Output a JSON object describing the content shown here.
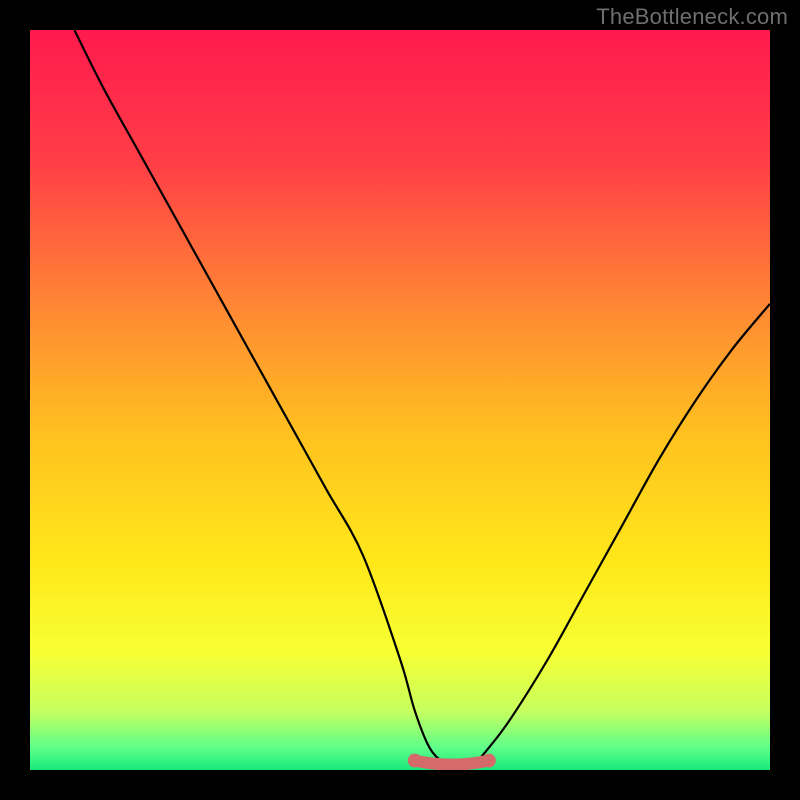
{
  "watermark": "TheBottleneck.com",
  "colors": {
    "black": "#000000",
    "curve": "#000000",
    "highlight": "#d46a6a",
    "gradient_stops": [
      {
        "offset": 0.0,
        "color": "#ff1a4d"
      },
      {
        "offset": 0.18,
        "color": "#ff3e47"
      },
      {
        "offset": 0.38,
        "color": "#ff8a33"
      },
      {
        "offset": 0.55,
        "color": "#ffc21f"
      },
      {
        "offset": 0.72,
        "color": "#ffe81a"
      },
      {
        "offset": 0.84,
        "color": "#f7ff33"
      },
      {
        "offset": 0.92,
        "color": "#c6ff5e"
      },
      {
        "offset": 0.97,
        "color": "#5eff8a"
      },
      {
        "offset": 1.0,
        "color": "#17e87a"
      }
    ]
  },
  "chart_data": {
    "type": "line",
    "title": "",
    "xlabel": "",
    "ylabel": "",
    "xlim": [
      0,
      100
    ],
    "ylim": [
      0,
      100
    ],
    "x": [
      6,
      10,
      15,
      20,
      25,
      30,
      35,
      40,
      45,
      50,
      52,
      54,
      56,
      58,
      60,
      62,
      65,
      70,
      75,
      80,
      85,
      90,
      95,
      100
    ],
    "values": [
      100,
      92,
      83,
      74,
      65,
      56,
      47,
      38,
      29,
      15,
      8,
      3,
      1,
      1,
      1,
      3,
      7,
      15,
      24,
      33,
      42,
      50,
      57,
      63
    ],
    "highlight_region": {
      "x_start": 52,
      "x_end": 62,
      "y": 1
    }
  }
}
